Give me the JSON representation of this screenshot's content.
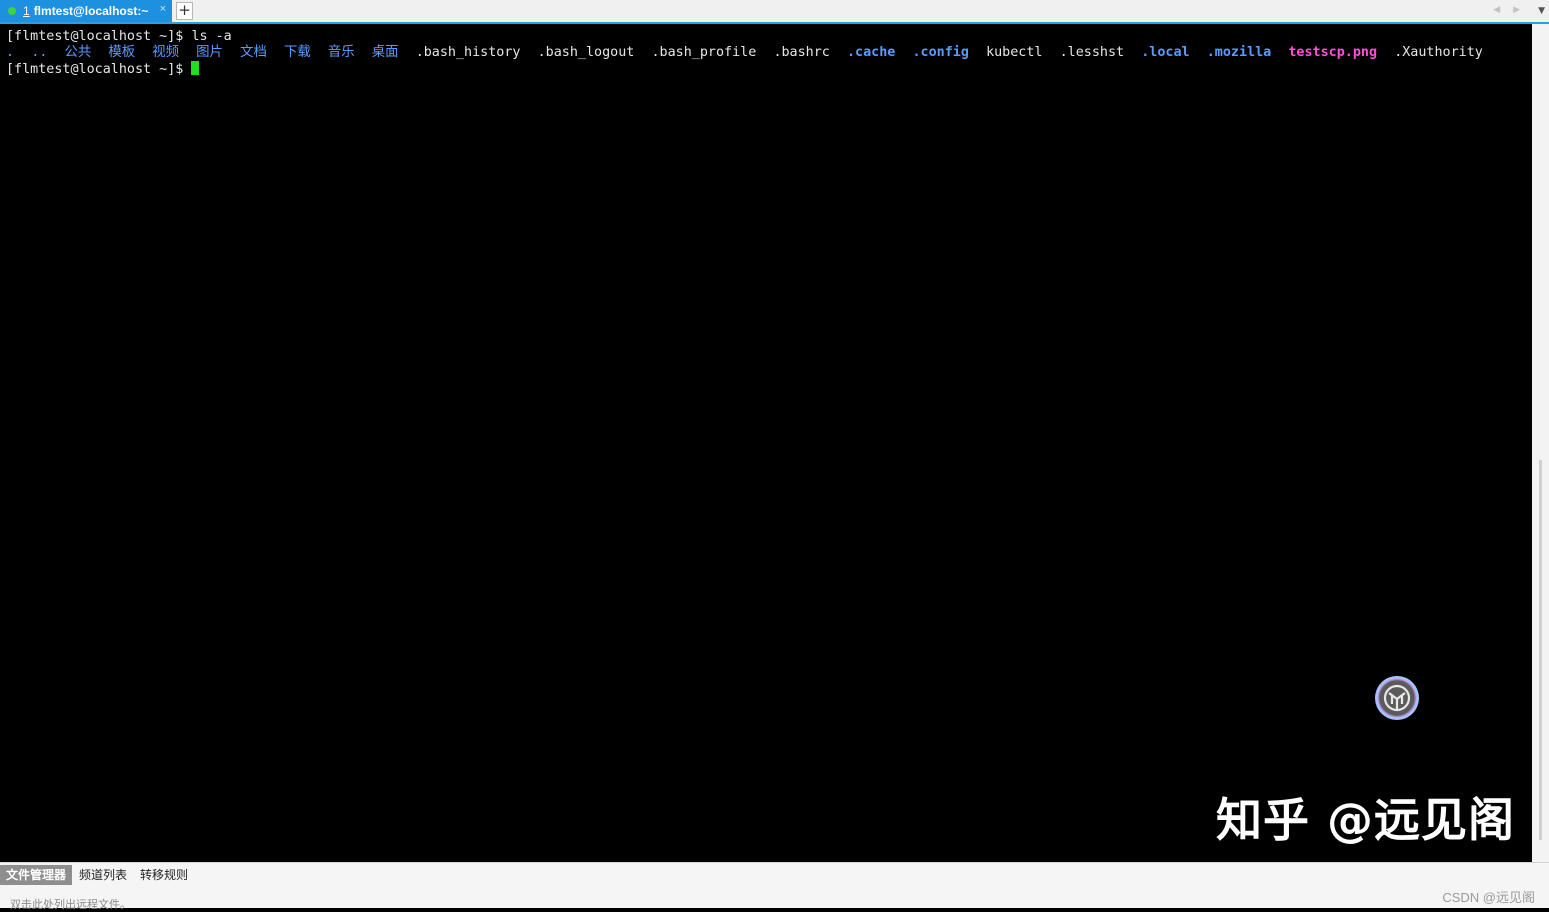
{
  "tabbar": {
    "tab": {
      "number": "1",
      "title": "flmtest@localhost:~",
      "close": "×"
    },
    "new_tab": "+",
    "nav": "◀ ▶",
    "menu": "▼"
  },
  "terminal": {
    "line1": {
      "prompt": "[flmtest@localhost ~]$ ",
      "command": "ls -a"
    },
    "ls_output": [
      {
        "text": ".",
        "kind": "dir"
      },
      {
        "text": "..",
        "kind": "dir"
      },
      {
        "text": "公共",
        "kind": "dir"
      },
      {
        "text": "模板",
        "kind": "dir"
      },
      {
        "text": "视频",
        "kind": "dir"
      },
      {
        "text": "图片",
        "kind": "dir"
      },
      {
        "text": "文档",
        "kind": "dir"
      },
      {
        "text": "下载",
        "kind": "dir"
      },
      {
        "text": "音乐",
        "kind": "dir"
      },
      {
        "text": "桌面",
        "kind": "dir"
      },
      {
        "text": ".bash_history",
        "kind": "file"
      },
      {
        "text": ".bash_logout",
        "kind": "file"
      },
      {
        "text": ".bash_profile",
        "kind": "file"
      },
      {
        "text": ".bashrc",
        "kind": "file"
      },
      {
        "text": ".cache",
        "kind": "dirb"
      },
      {
        "text": ".config",
        "kind": "dirb"
      },
      {
        "text": "kubectl",
        "kind": "file"
      },
      {
        "text": ".lesshst",
        "kind": "file"
      },
      {
        "text": ".local",
        "kind": "dirb"
      },
      {
        "text": ".mozilla",
        "kind": "dirb"
      },
      {
        "text": "testscp.png",
        "kind": "img"
      },
      {
        "text": ".Xauthority",
        "kind": "file"
      }
    ],
    "line3": {
      "prompt": "[flmtest@localhost ~]$ "
    }
  },
  "watermark": "知乎 @远见阁",
  "bottom": {
    "tabs": [
      "文件管理器",
      "频道列表",
      "转移规则"
    ],
    "hint": "双击此处列出远程文件。",
    "credit": "CSDN @远见阁"
  },
  "colors": {
    "accent": "#1e90e0",
    "cursor": "#1fe01f",
    "dir": "#5b9bff",
    "image": "#ff4fd8"
  }
}
